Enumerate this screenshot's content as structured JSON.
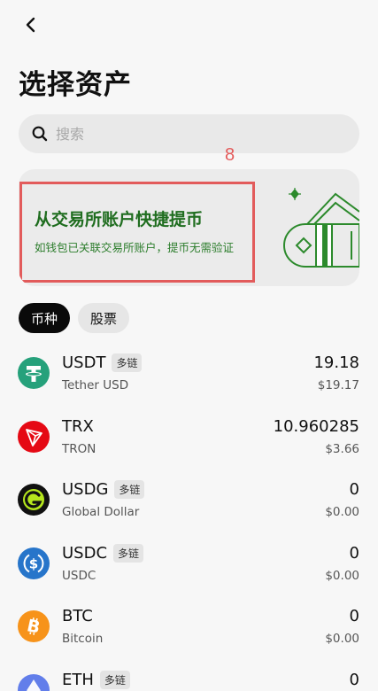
{
  "header": {
    "title": "选择资产"
  },
  "search": {
    "placeholder": "搜索"
  },
  "annotation_marker": "8",
  "banner": {
    "title": "从交易所账户快捷提币",
    "subtitle": "如钱包已关联交易所账户，提币无需验证"
  },
  "tabs": [
    {
      "label": "币种",
      "active": true
    },
    {
      "label": "股票",
      "active": false
    }
  ],
  "assets": [
    {
      "symbol": "USDT",
      "badge": "多链",
      "name": "Tether USD",
      "amount": "19.18",
      "value": "$19.17",
      "icon": "tether-icon",
      "color": "#26a17b"
    },
    {
      "symbol": "TRX",
      "badge": "",
      "name": "TRON",
      "amount": "10.960285",
      "value": "$3.66",
      "icon": "tron-icon",
      "color": "#e50914"
    },
    {
      "symbol": "USDG",
      "badge": "多链",
      "name": "Global Dollar",
      "amount": "0",
      "value": "$0.00",
      "icon": "usdg-icon",
      "color": "#111111"
    },
    {
      "symbol": "USDC",
      "badge": "多链",
      "name": "USDC",
      "amount": "0",
      "value": "$0.00",
      "icon": "usdc-icon",
      "color": "#2775ca"
    },
    {
      "symbol": "BTC",
      "badge": "",
      "name": "Bitcoin",
      "amount": "0",
      "value": "$0.00",
      "icon": "bitcoin-icon",
      "color": "#f7931a"
    },
    {
      "symbol": "ETH",
      "badge": "多链",
      "name": "",
      "amount": "0",
      "value": "",
      "icon": "ethereum-icon",
      "color": "#627eea"
    }
  ]
}
